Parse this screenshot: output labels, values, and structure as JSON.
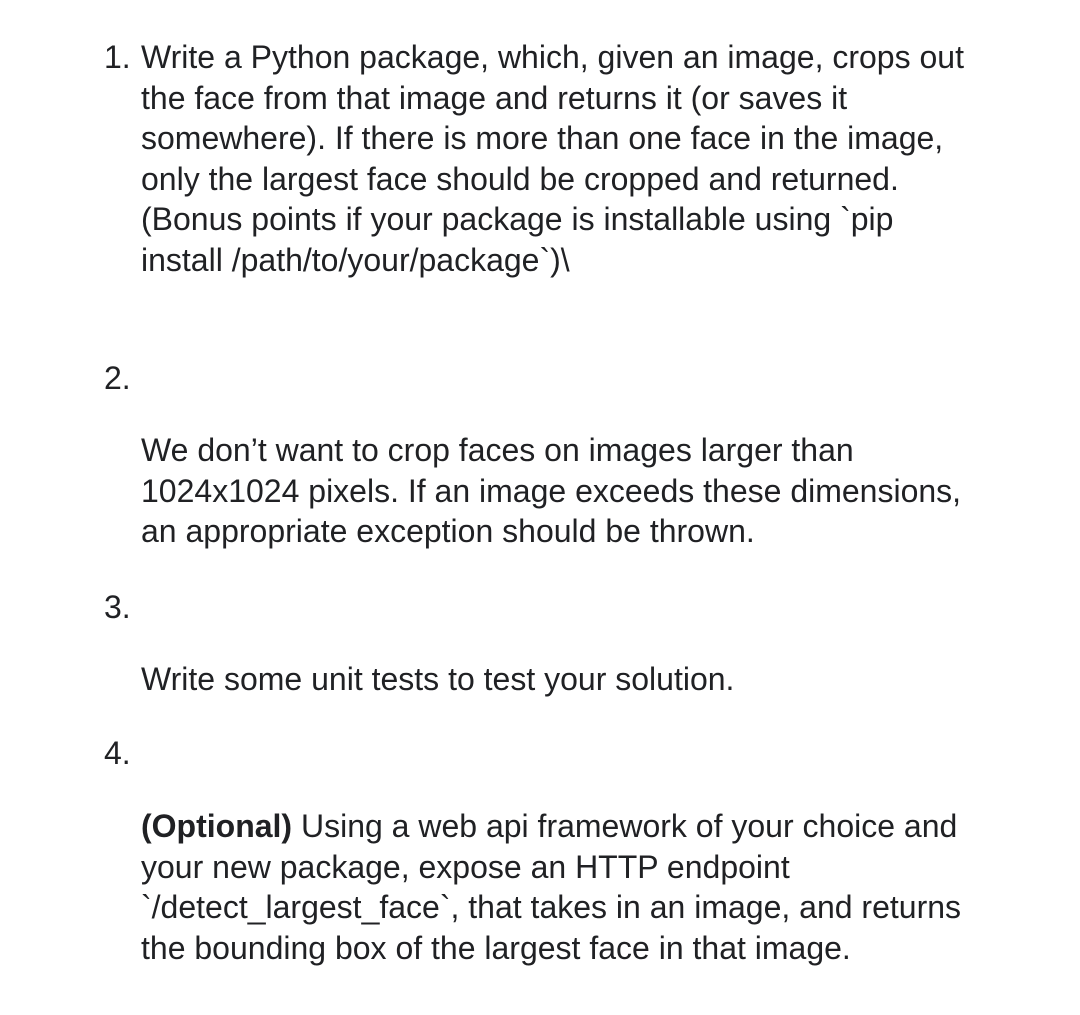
{
  "items": [
    {
      "number": "1.",
      "lines": [
        "Write a Python package, which, given an image, crops out",
        "the face from that image and returns it (or saves it",
        "somewhere). If there is more than one face in the image,",
        "only the largest face should be cropped and returned.",
        "(Bonus points if your package is installable using `pip",
        "install /path/to/your/package`)\\"
      ]
    },
    {
      "number": "2.",
      "lines": [
        "We don’t want to crop faces on images larger than",
        "1024x1024 pixels. If an image exceeds these dimensions,",
        "an appropriate exception should be thrown."
      ]
    },
    {
      "number": "3.",
      "lines": [
        "Write some unit tests to test your solution."
      ]
    },
    {
      "number": "4.",
      "bold_prefix": "(Optional)",
      "first_line_rest": " Using a web api framework of your choice and",
      "lines": [
        "your new package, expose an HTTP endpoint",
        "`/detect_largest_face`, that takes in an image, and returns",
        "the bounding box of the largest face in that image."
      ]
    }
  ]
}
